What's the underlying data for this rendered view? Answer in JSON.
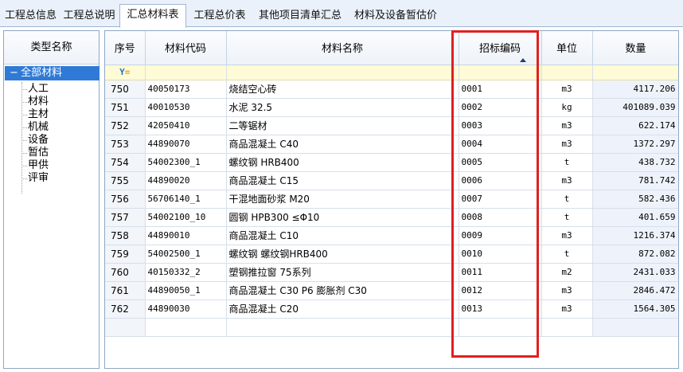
{
  "tabs": [
    {
      "label": "工程总信息"
    },
    {
      "label": "工程总说明"
    },
    {
      "label": "汇总材料表"
    },
    {
      "label": "工程总价表"
    },
    {
      "label": "其他项目清单汇总"
    },
    {
      "label": "材料及设备暂估价"
    }
  ],
  "tree": {
    "header": "类型名称",
    "root": {
      "toggle": "−",
      "label": "全部材料"
    },
    "items": [
      {
        "label": "人工"
      },
      {
        "label": "材料"
      },
      {
        "label": "主材"
      },
      {
        "label": "机械"
      },
      {
        "label": "设备"
      },
      {
        "label": "暂估"
      },
      {
        "label": "甲供"
      },
      {
        "label": "评审"
      }
    ]
  },
  "table": {
    "columns": {
      "seq": "序号",
      "code": "材料代码",
      "name": "材料名称",
      "bid_code": "招标编码",
      "unit": "单位",
      "qty": "数量"
    },
    "sort_column": "bid_code",
    "filter_icon": "filter-icon",
    "rows": [
      {
        "seq": "750",
        "code": "40050173",
        "name": "烧结空心砖",
        "bid_code": "0001",
        "unit": "m3",
        "qty": "4117.206"
      },
      {
        "seq": "751",
        "code": "40010530",
        "name": "水泥 32.5",
        "bid_code": "0002",
        "unit": "kg",
        "qty": "401089.039"
      },
      {
        "seq": "752",
        "code": "42050410",
        "name": "二等锯材",
        "bid_code": "0003",
        "unit": "m3",
        "qty": "622.174"
      },
      {
        "seq": "753",
        "code": "44890070",
        "name": "商品混凝土 C40",
        "bid_code": "0004",
        "unit": "m3",
        "qty": "1372.297"
      },
      {
        "seq": "754",
        "code": "54002300_1",
        "name": "螺纹钢 HRB400",
        "bid_code": "0005",
        "unit": "t",
        "qty": "438.732"
      },
      {
        "seq": "755",
        "code": "44890020",
        "name": "商品混凝土 C15",
        "bid_code": "0006",
        "unit": "m3",
        "qty": "781.742"
      },
      {
        "seq": "756",
        "code": "56706140_1",
        "name": "干混地面砂浆 M20",
        "bid_code": "0007",
        "unit": "t",
        "qty": "582.436"
      },
      {
        "seq": "757",
        "code": "54002100_10",
        "name": "圆钢 HPB300 ≤Φ10",
        "bid_code": "0008",
        "unit": "t",
        "qty": "401.659"
      },
      {
        "seq": "758",
        "code": "44890010",
        "name": "商品混凝土 C10",
        "bid_code": "0009",
        "unit": "m3",
        "qty": "1216.374"
      },
      {
        "seq": "759",
        "code": "54002500_1",
        "name": "螺纹钢 螺纹钢HRB400",
        "bid_code": "0010",
        "unit": "t",
        "qty": "872.082"
      },
      {
        "seq": "760",
        "code": "40150332_2",
        "name": "塑钢推拉窗 75系列",
        "bid_code": "0011",
        "unit": "m2",
        "qty": "2431.033"
      },
      {
        "seq": "761",
        "code": "44890050_1",
        "name": "商品混凝土 C30 P6 膨胀剂 C30",
        "bid_code": "0012",
        "unit": "m3",
        "qty": "2846.472"
      },
      {
        "seq": "762",
        "code": "44890030",
        "name": "商品混凝土 C20",
        "bid_code": "0013",
        "unit": "m3",
        "qty": "1564.305"
      }
    ]
  },
  "colors": {
    "highlight_box": "#e02020",
    "tree_selected": "#2f7ad6",
    "filter_row": "#fffbd6"
  }
}
